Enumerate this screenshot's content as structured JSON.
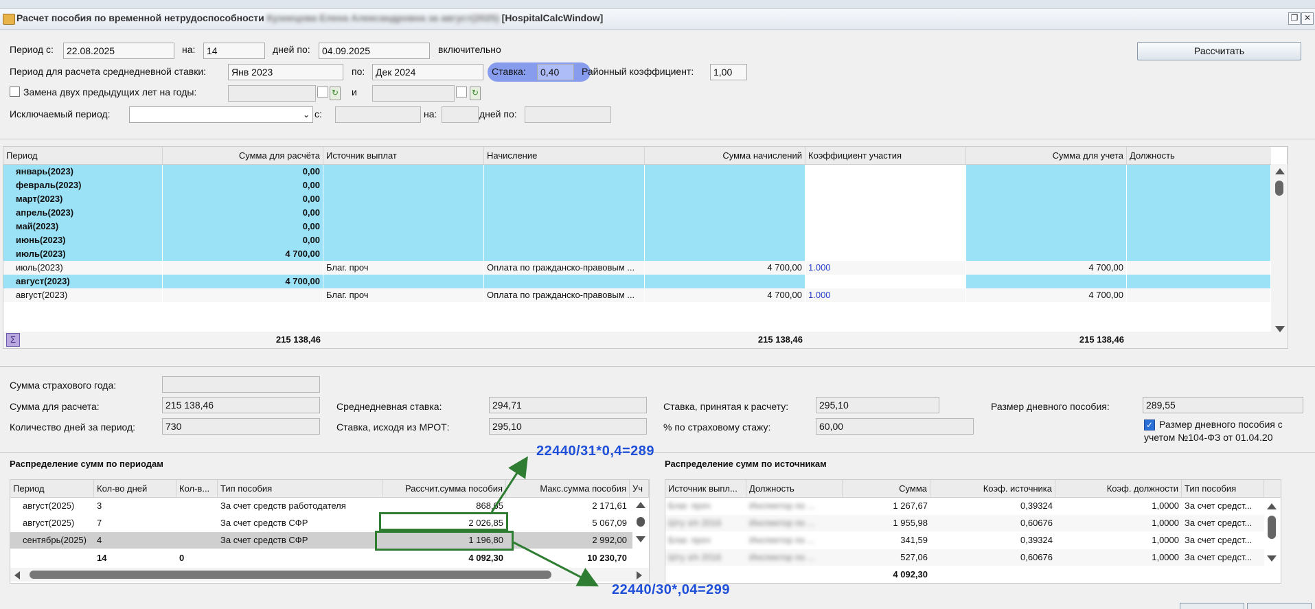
{
  "window": {
    "title_visible": "Расчет пособия по временной нетрудоспособности",
    "title_blurred": "Кузнецова Елена Александровна за август(2025)",
    "title_class": "[HospitalCalcWindow]"
  },
  "params": {
    "period_from_label": "Период с:",
    "period_from": "22.08.2025",
    "on_label": "на:",
    "days_value": "14",
    "days_to_label": "дней по:",
    "period_to": "04.09.2025",
    "inclusive": "включительно",
    "calc_button": "Рассчитать",
    "avg_period_label": "Период для расчета среднедневной ставки:",
    "avg_from": "Янв 2023",
    "avg_to_label": "по:",
    "avg_to": "Дек 2024",
    "rate_label": "Ставка:",
    "rate_value": "0,40",
    "district_label": "Районный коэффициент:",
    "district_value": "1,00",
    "replace_label": "Замена двух предыдущих лет на годы:",
    "and_label": "и",
    "excluded_label": "Исключаемый период:",
    "excl_from_label": "с:",
    "excl_on_label": "на:",
    "excl_days_label": "дней по:"
  },
  "main_grid": {
    "headers": [
      "Период",
      "Сумма для расчёта",
      "Источник выплат",
      "Начисление",
      "Сумма начислений",
      "Коэффициент участия",
      "Сумма для учета",
      "Должность"
    ],
    "rows": [
      {
        "period": "январь(2023)",
        "sum": "0,00",
        "source": "",
        "accrual": "",
        "accrued": "",
        "coef": "",
        "account": "",
        "position": "",
        "group": true
      },
      {
        "period": "февраль(2023)",
        "sum": "0,00",
        "source": "",
        "accrual": "",
        "accrued": "",
        "coef": "",
        "account": "",
        "position": "",
        "group": true
      },
      {
        "period": "март(2023)",
        "sum": "0,00",
        "source": "",
        "accrual": "",
        "accrued": "",
        "coef": "",
        "account": "",
        "position": "",
        "group": true
      },
      {
        "period": "апрель(2023)",
        "sum": "0,00",
        "source": "",
        "accrual": "",
        "accrued": "",
        "coef": "",
        "account": "",
        "position": "",
        "group": true
      },
      {
        "period": "май(2023)",
        "sum": "0,00",
        "source": "",
        "accrual": "",
        "accrued": "",
        "coef": "",
        "account": "",
        "position": "",
        "group": true
      },
      {
        "period": "июнь(2023)",
        "sum": "0,00",
        "source": "",
        "accrual": "",
        "accrued": "",
        "coef": "",
        "account": "",
        "position": "",
        "group": true
      },
      {
        "period": "июль(2023)",
        "sum": "4 700,00",
        "source": "",
        "accrual": "",
        "accrued": "",
        "coef": "",
        "account": "",
        "position": "",
        "group": true
      },
      {
        "period": "июль(2023)",
        "sum": "",
        "source": "Благ. проч",
        "accrual": "Оплата по гражданско-правовым ...",
        "accrued": "4 700,00",
        "coef": "1.000",
        "account": "4 700,00",
        "position": "",
        "group": false
      },
      {
        "period": "август(2023)",
        "sum": "4 700,00",
        "source": "",
        "accrual": "",
        "accrued": "",
        "coef": "",
        "account": "",
        "position": "",
        "group": true
      },
      {
        "period": "август(2023)",
        "sum": "",
        "source": "Благ. проч",
        "accrual": "Оплата по гражданско-правовым ...",
        "accrued": "4 700,00",
        "coef": "1.000",
        "account": "4 700,00",
        "position": "",
        "group": false
      }
    ],
    "totals": {
      "sum": "215 138,46",
      "accrued": "215 138,46",
      "account": "215 138,46"
    },
    "sigma": "Σ"
  },
  "summary": {
    "ins_year_label": "Сумма страхового года:",
    "ins_year_value": "",
    "calc_sum_label": "Сумма для расчета:",
    "calc_sum_value": "215 138,46",
    "avg_rate_label": "Среднедневная ставка:",
    "avg_rate_value": "294,71",
    "accepted_rate_label": "Ставка, принятая к расчету:",
    "accepted_rate_value": "295,10",
    "daily_size_label": "Размер дневного пособия:",
    "daily_size_value": "289,55",
    "days_count_label": "Количество дней за период:",
    "days_count_value": "730",
    "mrot_rate_label": "Ставка, исходя из МРОТ:",
    "mrot_rate_value": "295,10",
    "stazh_label": "% по страховому стажу:",
    "stazh_value": "60,00",
    "law_check_label": "Размер дневного пособия с учетом №104-ФЗ от 01.04.20"
  },
  "periods": {
    "title": "Распределение сумм по периодам",
    "headers": [
      "Период",
      "Кол-во дней",
      "Кол-в...",
      "Тип пособия",
      "Рассчит.сумма пособия",
      "Макс.сумма пособия",
      "Уч"
    ],
    "rows": [
      {
        "period": "август(2025)",
        "days": "3",
        "kol": "",
        "type": "За счет средств работодателя",
        "calc": "868,65",
        "max": "2 171,61"
      },
      {
        "period": "август(2025)",
        "days": "7",
        "kol": "",
        "type": "За счет средств СФР",
        "calc": "2 026,85",
        "max": "5 067,09"
      },
      {
        "period": "сентябрь(2025)",
        "days": "4",
        "kol": "",
        "type": "За счет средств СФР",
        "calc": "1 196,80",
        "max": "2 992,00"
      }
    ],
    "totals": {
      "days": "14",
      "kol": "0",
      "calc": "4 092,30",
      "max": "10 230,70"
    }
  },
  "sources": {
    "title": "Распределение сумм по источникам",
    "headers": [
      "Источник выпл...",
      "Должность",
      "Сумма",
      "Коэф. источника",
      "Коэф. должности",
      "Тип пособия"
    ],
    "rows": [
      {
        "source": "Благ. проч",
        "position": "Инспектор по ...",
        "sum": "1 267,67",
        "src_coef": "0,39324",
        "pos_coef": "1,0000",
        "type": "За счет средст..."
      },
      {
        "source": "Шту з/п 2016",
        "position": "Инспектор по ...",
        "sum": "1 955,98",
        "src_coef": "0,60676",
        "pos_coef": "1,0000",
        "type": "За счет средст..."
      },
      {
        "source": "Благ. проч",
        "position": "Инспектор по ...",
        "sum": "341,59",
        "src_coef": "0,39324",
        "pos_coef": "1,0000",
        "type": "За счет средст..."
      },
      {
        "source": "Шту з/п 2016",
        "position": "Инспектор по ...",
        "sum": "527,06",
        "src_coef": "0,60676",
        "pos_coef": "1,0000",
        "type": "За счет средст..."
      }
    ],
    "total": "4 092,30"
  },
  "annotations": {
    "top": "22440/31*0,4=289",
    "bottom": "22440/30*,04=299"
  }
}
